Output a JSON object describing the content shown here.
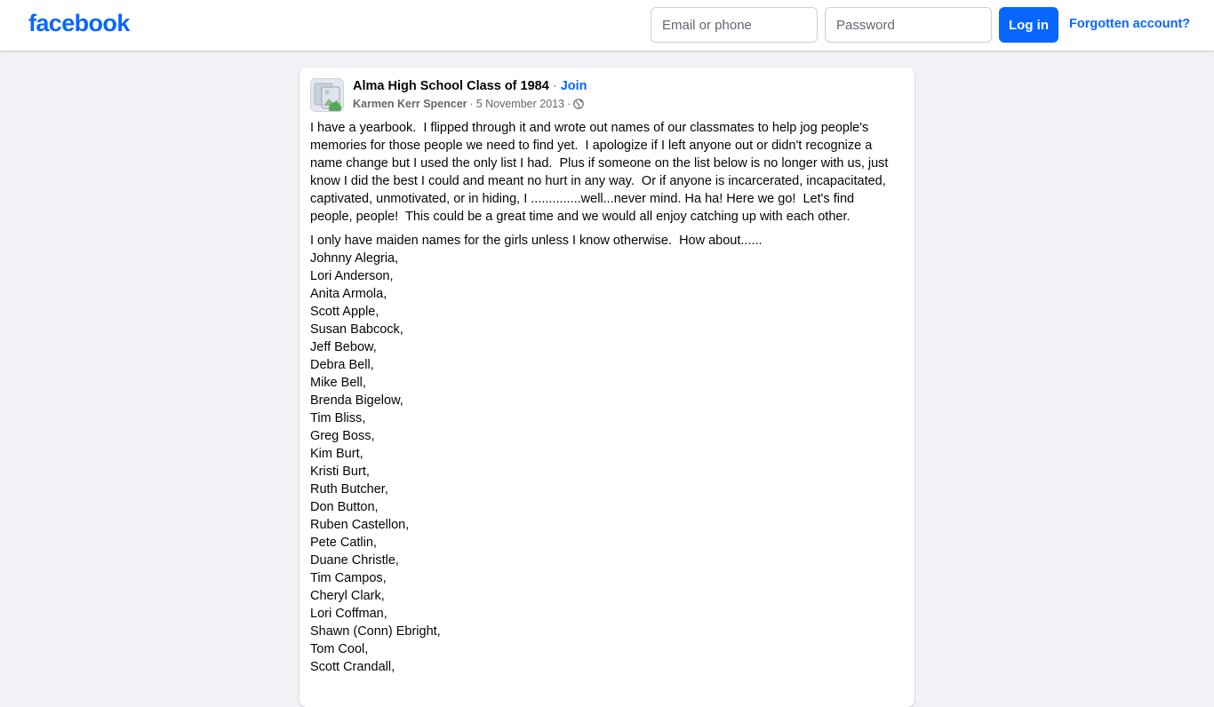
{
  "header": {
    "logo_text": "facebook",
    "email_placeholder": "Email or phone",
    "password_placeholder": "Password",
    "login_label": "Log in",
    "forgot_label": "Forgotten account?",
    "brand_color": "#0866ff"
  },
  "post": {
    "group_name": "Alma High School Class of 1984",
    "separator": "·",
    "join_label": "Join",
    "author": "Karmen Kerr Spencer",
    "date": "5 November 2013",
    "privacy_icon": "globe-icon",
    "paragraph_1": "I have a yearbook.  I flipped through it and wrote out names of our classmates to help jog people's memories for those people we need to find yet.  I apologize if I left anyone out or didn't recognize a name change but I used the only list I had.  Plus if someone on the list below is no longer with us, just know I did the best I could and meant no hurt in any way.  Or if anyone is incarcerated, incapacitated, captivated, unmotivated, or in hiding, I ..............well...never mind. Ha ha! Here we go!  Let's find people, people!  This could be a great time and we would all enjoy catching up with each other.",
    "intro_line": "I only have maiden names for the girls unless I know otherwise.  How about......",
    "names": [
      "Johnny Alegria,",
      "Lori Anderson,",
      "Anita Armola,",
      "Scott Apple,",
      "Susan Babcock,",
      "Jeff Bebow,",
      "Debra Bell,",
      "Mike Bell,",
      "Brenda Bigelow,",
      "Tim Bliss,",
      "Greg Boss,",
      "Kim Burt,",
      "Kristi Burt,",
      "Ruth Butcher,",
      "Don Button,",
      "Ruben Castellon,",
      "Pete Catlin,",
      "Duane Christle,",
      "Tim Campos,",
      "Cheryl Clark,",
      "Lori Coffman,",
      "Shawn (Conn) Ebright,",
      "Tom Cool,",
      "Scott Crandall,"
    ]
  }
}
